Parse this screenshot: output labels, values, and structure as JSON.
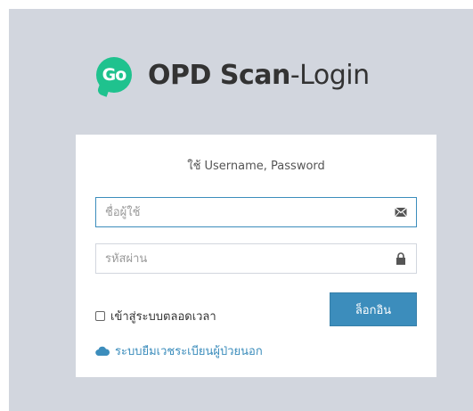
{
  "header": {
    "logo_text": "Go",
    "title_bold": "OPD Scan",
    "title_light": "-Login"
  },
  "login": {
    "message": "ใช้ Username, Password",
    "username_placeholder": "ชื่อผู้ใช้",
    "username_icon": "envelope-icon",
    "password_placeholder": "รหัสผ่าน",
    "password_icon": "lock-icon",
    "remember_label": "เข้าสู่ระบบตลอดเวลา",
    "remember_checked": false,
    "login_button": "ล็อกอิน",
    "borrow_link": "ระบบยืมเวชระเบียนผู้ป่วยนอก",
    "borrow_icon": "cloud-icon"
  },
  "colors": {
    "background": "#d2d6de",
    "brand_green": "#1fc28e",
    "accent_blue": "#3c8dbc"
  }
}
